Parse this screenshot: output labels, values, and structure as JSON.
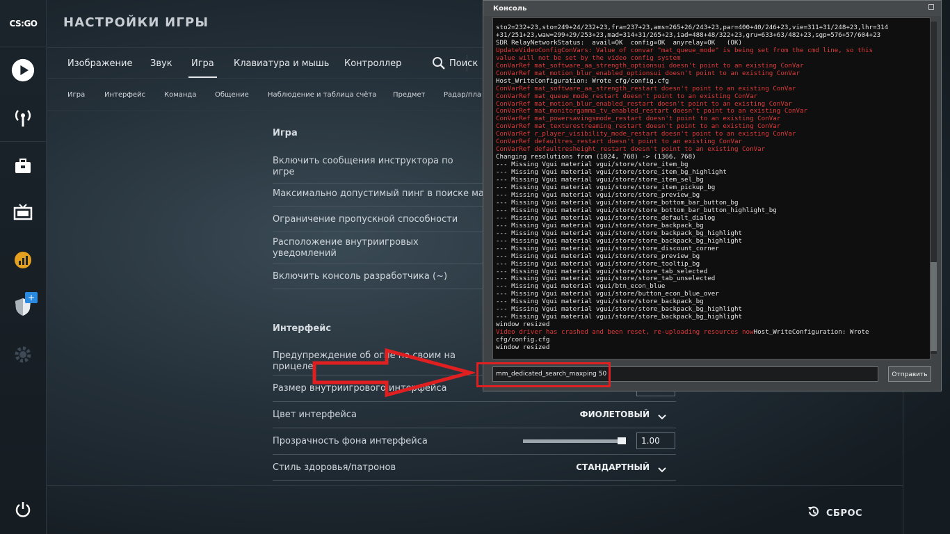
{
  "app": {
    "logo": "CS:GO",
    "title": "НАСТРОЙКИ ИГРЫ"
  },
  "sidebar": {
    "icons": [
      "play-icon",
      "broadcast-icon",
      "inventory-icon",
      "watch-tv-icon",
      "stats-icon",
      "shield-icon",
      "gear-icon",
      "power-icon"
    ],
    "badge": "+"
  },
  "tabs": [
    "Изображение",
    "Звук",
    "Игра",
    "Клавиатура и мышь",
    "Контроллер"
  ],
  "active_tab": "Игра",
  "search_label": "Поиск",
  "subtabs": [
    "Игра",
    "Интерфейс",
    "Команда",
    "Общение",
    "Наблюдение и таблица счёта",
    "Предмет",
    "Радар/пла"
  ],
  "sections": {
    "game": {
      "title": "Игра",
      "rows": [
        "Включить сообщения инструктора по игре",
        "Максимально допустимый пинг в поиске ма",
        "Ограничение пропускной способности",
        "Расположение внутриигровых уведомлений",
        "Включить консоль разработчика (~)"
      ]
    },
    "interface": {
      "title": "Интерфейс",
      "rows": [
        {
          "label": "Предупреждение об огне по своим на прицеле"
        },
        {
          "label": "Размер внутриигрового интерфейса"
        },
        {
          "label": "Цвет интерфейса",
          "value": "ФИОЛЕТОВЫЙ"
        },
        {
          "label": "Прозрачность фона интерфейса",
          "value": "1.00",
          "level": 1.0
        },
        {
          "label": "Стиль здоровья/патронов",
          "value": "СТАНДАРТНЫЙ"
        }
      ]
    }
  },
  "console": {
    "title": "Консоль",
    "lines": [
      {
        "t": "sto2=232+23,sto=249+24/232+23,fra=237+23,ams=265+26/243+23,par=400+40/246+23,vie=311+31/248+23,lhr=314",
        "c": "n"
      },
      {
        "t": "+31/251+23,waw=299+29/253+23,mad=314+31/265+23,iad=488+48/322+23,gru=633+63/482+23,sgp=576+57/604+23",
        "c": "n"
      },
      {
        "t": "SDR RelayNetworkStatus:  avail=OK  config=OK  anyrelay=OK   (OK)",
        "c": "n"
      },
      {
        "t": "UpdateVideoConfigConVars: Value of convar \"mat_queue_mode\" is being set from the cmd line, so this",
        "c": "e"
      },
      {
        "t": "value will not be set by the video config system",
        "c": "e"
      },
      {
        "t": "ConVarRef mat_software_aa_strength_optionsui doesn't point to an existing ConVar",
        "c": "e"
      },
      {
        "t": "ConVarRef mat_motion_blur_enabled_optionsui doesn't point to an existing ConVar",
        "c": "e"
      },
      {
        "t": "Host_WriteConfiguration: Wrote cfg/config.cfg",
        "c": "n"
      },
      {
        "t": "ConVarRef mat_software_aa_strength_restart doesn't point to an existing ConVar",
        "c": "e"
      },
      {
        "t": "ConVarRef mat_queue_mode_restart doesn't point to an existing ConVar",
        "c": "e"
      },
      {
        "t": "ConVarRef mat_motion_blur_enabled_restart doesn't point to an existing ConVar",
        "c": "e"
      },
      {
        "t": "ConVarRef mat_monitorgamma_tv_enabled_restart doesn't point to an existing ConVar",
        "c": "e"
      },
      {
        "t": "ConVarRef mat_powersavingsmode_restart doesn't point to an existing ConVar",
        "c": "e"
      },
      {
        "t": "ConVarRef mat_texturestreaming_restart doesn't point to an existing ConVar",
        "c": "e"
      },
      {
        "t": "ConVarRef r_player_visibility_mode_restart doesn't point to an existing ConVar",
        "c": "e"
      },
      {
        "t": "ConVarRef defaultres_restart doesn't point to an existing ConVar",
        "c": "e"
      },
      {
        "t": "ConVarRef defaultresheight_restart doesn't point to an existing ConVar",
        "c": "e"
      },
      {
        "t": "Changing resolutions from (1024, 768) -> (1366, 768)",
        "c": "n"
      },
      {
        "t": "--- Missing Vgui material vgui/store/store_item_bg",
        "c": "n"
      },
      {
        "t": "--- Missing Vgui material vgui/store/store_item_bg_highlight",
        "c": "n"
      },
      {
        "t": "--- Missing Vgui material vgui/store/store_item_sel_bg",
        "c": "n"
      },
      {
        "t": "--- Missing Vgui material vgui/store/store_item_pickup_bg",
        "c": "n"
      },
      {
        "t": "--- Missing Vgui material vgui/store/store_preview_bg",
        "c": "n"
      },
      {
        "t": "--- Missing Vgui material vgui/store/store_bottom_bar_button_bg",
        "c": "n"
      },
      {
        "t": "--- Missing Vgui material vgui/store/store_bottom_bar_button_highlight_bg",
        "c": "n"
      },
      {
        "t": "--- Missing Vgui material vgui/store/store_default_dialog",
        "c": "n"
      },
      {
        "t": "--- Missing Vgui material vgui/store/store_backpack_bg",
        "c": "n"
      },
      {
        "t": "--- Missing Vgui material vgui/store/store_backpack_bg_highlight",
        "c": "n"
      },
      {
        "t": "--- Missing Vgui material vgui/store/store_backpack_bg_highlight",
        "c": "n"
      },
      {
        "t": "--- Missing Vgui material vgui/store/store_discount_corner",
        "c": "n"
      },
      {
        "t": "--- Missing Vgui material vgui/store/store_preview_bg",
        "c": "n"
      },
      {
        "t": "--- Missing Vgui material vgui/store/store_tooltip_bg",
        "c": "n"
      },
      {
        "t": "--- Missing Vgui material vgui/store/store_tab_selected",
        "c": "n"
      },
      {
        "t": "--- Missing Vgui material vgui/store/store_tab_unselected",
        "c": "n"
      },
      {
        "t": "--- Missing Vgui material vgui/btn_econ_blue",
        "c": "n"
      },
      {
        "t": "--- Missing Vgui material vgui/store/button_econ_blue_over",
        "c": "n"
      },
      {
        "t": "--- Missing Vgui material vgui/store/store_backpack_bg",
        "c": "n"
      },
      {
        "t": "--- Missing Vgui material vgui/store/store_backpack_bg_highlight",
        "c": "n"
      },
      {
        "t": "--- Missing Vgui material vgui/store/store_backpack_bg_highlight",
        "c": "n"
      },
      {
        "t": "window resized",
        "c": "n"
      },
      {
        "t": "Video driver has crashed and been reset, re-uploading resources now|Host_WriteConfiguration: Wrote",
        "c": "mix"
      },
      {
        "t": "cfg/config.cfg",
        "c": "n"
      },
      {
        "t": "window resized",
        "c": "n"
      }
    ],
    "input_value": "mm_dedicated_search_maxping 50",
    "send_label": "Отправить"
  },
  "reset_label": "СБРОС",
  "colors": {
    "highlight": "#e02020",
    "error_text": "#e03a3a"
  }
}
